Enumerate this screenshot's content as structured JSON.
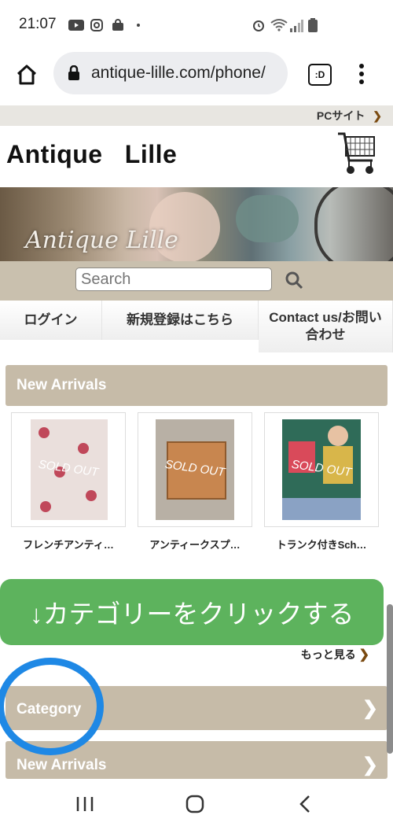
{
  "status_bar": {
    "time": "21:07"
  },
  "browser": {
    "url": "antique-lille.com/phone/",
    "tab_switcher_label": ":D"
  },
  "site": {
    "pc_link": "PCサイト",
    "logo": "Antique   Lille",
    "banner_text": "Antique Lille",
    "search_placeholder": "Search",
    "nav": [
      "ログイン",
      "新規登録はこちら",
      "Contact us/お問い合わせ"
    ],
    "new_arrivals_title": "New Arrivals",
    "products": [
      {
        "name": "フレンチアンティ…",
        "badge": "SOLD OUT"
      },
      {
        "name": "アンティークスプ…",
        "badge": "SOLD OUT"
      },
      {
        "name": "トランク付きSch…",
        "badge": "SOLD OUT"
      }
    ],
    "cta_text": "↓カテゴリーをクリックする",
    "more_link": "もっと見る",
    "sections": [
      "Category",
      "New Arrivals"
    ]
  },
  "colors": {
    "accent_green": "#5db35d",
    "section_tan": "#c6bba8",
    "ring_blue": "#1e88e5"
  }
}
